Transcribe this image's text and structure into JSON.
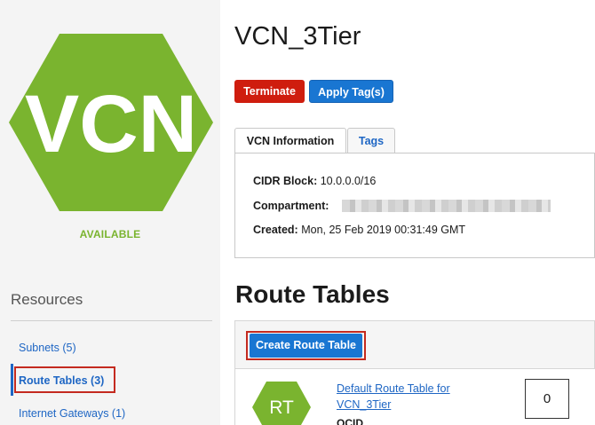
{
  "vcn": {
    "icon_text": "VCN",
    "status": "AVAILABLE",
    "name": "VCN_3Tier"
  },
  "actions": {
    "terminate": "Terminate",
    "apply_tags": "Apply Tag(s)"
  },
  "tabs": [
    {
      "label": "VCN Information",
      "active": true
    },
    {
      "label": "Tags",
      "active": false
    }
  ],
  "info": {
    "cidr_label": "CIDR Block:",
    "cidr_value": "10.0.0.0/16",
    "compartment_label": "Compartment:",
    "created_label": "Created:",
    "created_value": "Mon, 25 Feb 2019 00:31:49 GMT"
  },
  "resources": {
    "title": "Resources",
    "items": [
      {
        "label": "Subnets (5)"
      },
      {
        "label": "Route Tables (3)",
        "active": true
      },
      {
        "label": "Internet Gateways (1)"
      }
    ]
  },
  "route_tables": {
    "title": "Route Tables",
    "create_button": "Create Route Table",
    "rows": [
      {
        "icon_text": "RT",
        "name": "Default Route Table for VCN_3Tier",
        "ocid_label": "OCID",
        "rule_count": "0"
      }
    ]
  },
  "colors": {
    "vcn_green": "#7ab42f",
    "link_blue": "#1e66c4",
    "terminate_red": "#cf1d0e",
    "primary_blue": "#1976d2",
    "highlight_red": "#c42a1f"
  },
  "icons": {
    "vcn": "hexagon-vcn-icon",
    "route_table": "hexagon-rt-icon"
  }
}
